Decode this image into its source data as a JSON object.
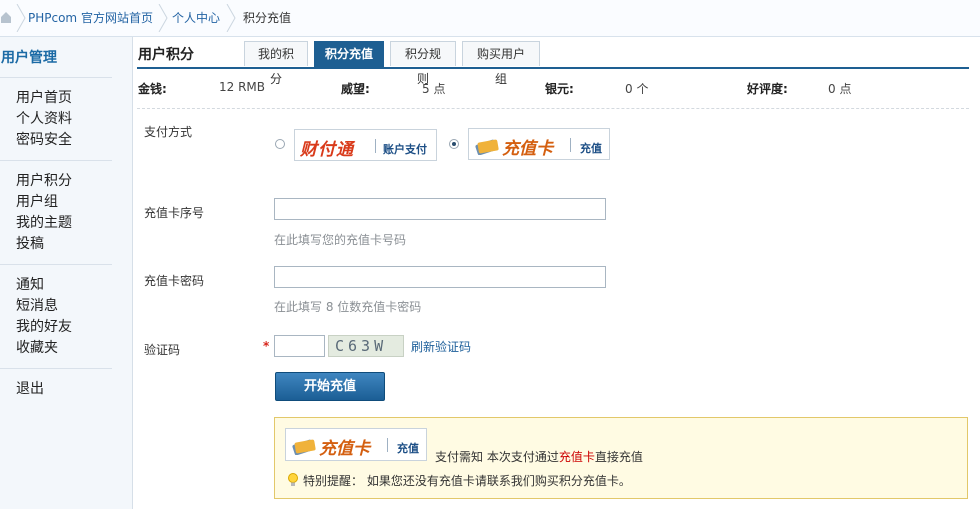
{
  "breadcrumb": {
    "items": [
      "PHPcom 官方网站首页",
      "个人中心",
      "积分充值"
    ]
  },
  "sidebar": {
    "title": "用户管理",
    "groups": [
      [
        "用户首页",
        "个人资料",
        "密码安全"
      ],
      [
        "用户积分",
        "用户组",
        "我的主题",
        "投稿"
      ],
      [
        "通知",
        "短消息",
        "我的好友",
        "收藏夹"
      ],
      [
        "退出"
      ]
    ]
  },
  "main": {
    "title": "用户积分",
    "tabs": [
      "我的积分",
      "积分充值",
      "积分规则",
      "购买用户组"
    ],
    "active_tab": 1
  },
  "stats": [
    {
      "label": "金钱:",
      "value": "12 RMB"
    },
    {
      "label": "威望:",
      "value": "5 点"
    },
    {
      "label": "银元:",
      "value": "0 个"
    },
    {
      "label": "好评度:",
      "value": "0 点"
    }
  ],
  "form": {
    "payment_label": "支付方式",
    "payment_options": [
      {
        "logo": "财付通",
        "caption": "账户支付",
        "selected": false
      },
      {
        "logo": "充值卡",
        "caption": "充值",
        "selected": true
      }
    ],
    "card_number_label": "充值卡序号",
    "card_number_value": "",
    "card_number_hint": "在此填写您的充值卡号码",
    "card_password_label": "充值卡密码",
    "card_password_value": "",
    "card_password_hint": "在此填写 8 位数充值卡密码",
    "captcha_label": "验证码",
    "required_mark": "*",
    "captcha_value": "",
    "captcha_text": "C63W",
    "refresh_label": "刷新验证码",
    "submit_label": "开始充值"
  },
  "notice": {
    "logo": "充值卡",
    "caption": "充值",
    "text_prefix": "支付需知 本次支付通过",
    "text_highlight": "充值卡",
    "text_suffix": "直接充值",
    "tip": "特别提醒：  如果您还没有充值卡请联系我们购买积分充值卡。"
  },
  "colors": {
    "accent": "#1e5f92",
    "link": "#2464a4",
    "highlight": "#cc0000",
    "notice_bg": "#fffbe3",
    "notice_border": "#e2c86a"
  }
}
